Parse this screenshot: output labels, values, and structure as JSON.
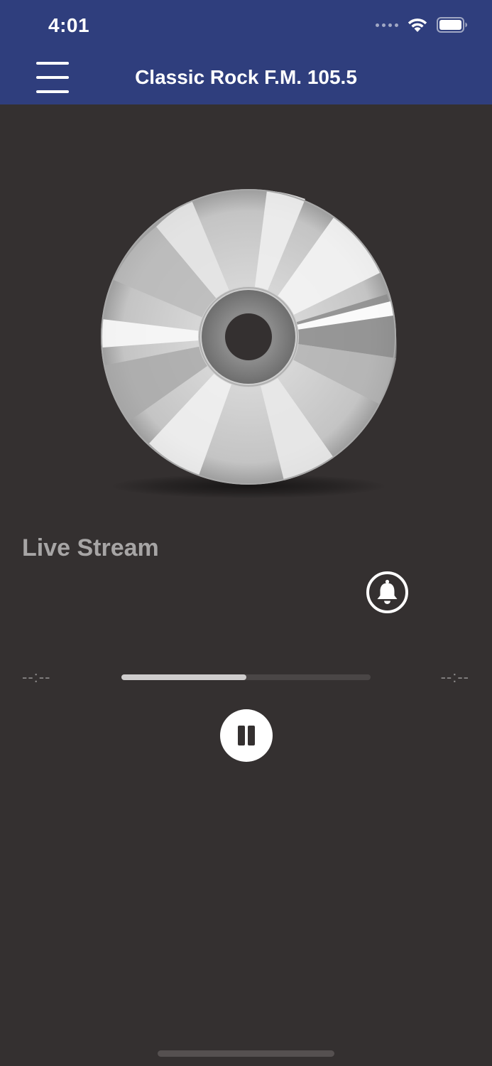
{
  "status_bar": {
    "time": "4:01",
    "icons": [
      "cellular-signal-icon",
      "wifi-icon",
      "battery-icon"
    ]
  },
  "header": {
    "title": "Classic Rock F.M. 105.5",
    "menu_icon": "hamburger-menu-icon",
    "background_color": "#2f3e7d"
  },
  "player": {
    "artwork": "compact-disc-icon",
    "stream_label": "Live Stream",
    "alert_icon": "bell-icon",
    "elapsed_time": "--:--",
    "remaining_time": "--:--",
    "progress_fraction": 0.5,
    "control_icon": "pause-icon"
  },
  "colors": {
    "background": "#343030",
    "header": "#2f3e7d",
    "label": "#a7a5a5",
    "progress_fill": "#cfcdcd",
    "progress_track": "#4a4646"
  }
}
